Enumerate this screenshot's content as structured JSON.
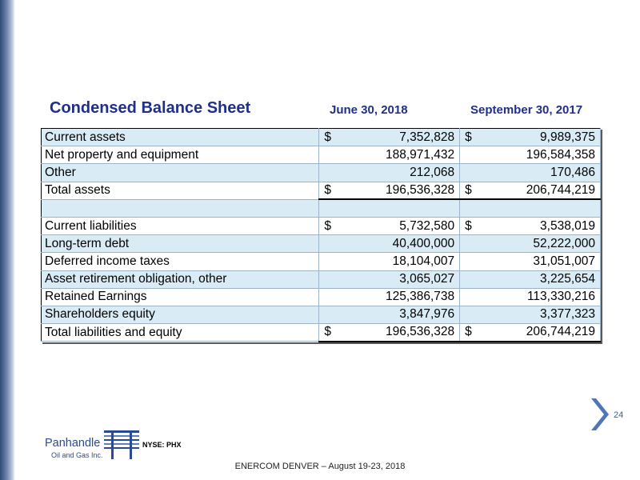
{
  "title": "Condensed Balance Sheet",
  "columns": [
    "June 30, 2018",
    "September 30, 2017"
  ],
  "rows": [
    {
      "label": "Current assets",
      "dollar": [
        "$",
        "$"
      ],
      "values": [
        "7,352,828",
        "9,989,375"
      ]
    },
    {
      "label": "Net property and equipment",
      "dollar": [
        "",
        ""
      ],
      "values": [
        "188,971,432",
        "196,584,358"
      ]
    },
    {
      "label": "Other",
      "dollar": [
        "",
        ""
      ],
      "values": [
        "212,068",
        "170,486"
      ]
    },
    {
      "label": "Total assets",
      "dollar": [
        "$",
        "$"
      ],
      "values": [
        "196,536,328",
        "206,744,219"
      ]
    },
    {
      "label": "",
      "dollar": [
        "",
        ""
      ],
      "values": [
        "",
        ""
      ]
    },
    {
      "label": "Current liabilities",
      "dollar": [
        "$",
        "$"
      ],
      "values": [
        "5,732,580",
        "3,538,019"
      ]
    },
    {
      "label": "Long-term debt",
      "dollar": [
        "",
        ""
      ],
      "values": [
        "40,400,000",
        "52,222,000"
      ]
    },
    {
      "label": "Deferred income taxes",
      "dollar": [
        "",
        ""
      ],
      "values": [
        "18,104,007",
        "31,051,007"
      ]
    },
    {
      "label": "Asset retirement obligation, other",
      "dollar": [
        "",
        ""
      ],
      "values": [
        "3,065,027",
        "3,225,654"
      ]
    },
    {
      "label": "Retained Earnings",
      "dollar": [
        "",
        ""
      ],
      "values": [
        "125,386,738",
        "113,330,216"
      ]
    },
    {
      "label": "Shareholders equity",
      "dollar": [
        "",
        ""
      ],
      "values": [
        "3,847,976",
        "3,377,323"
      ]
    },
    {
      "label": "Total liabilities and equity",
      "dollar": [
        "$",
        "$"
      ],
      "values": [
        "196,536,328",
        "206,744,219"
      ]
    }
  ],
  "page_number": "24",
  "logo": {
    "name": "Panhandle",
    "sub": "Oil and Gas Inc.",
    "ticker": "NYSE: PHX"
  },
  "footer": "ENERCOM DENVER – August 19-23, 2018",
  "colors": {
    "title": "#1f2f8a",
    "row_shade": "#d9ecf6",
    "chevron": "#4f77b8",
    "left_bar": "#2e4a78"
  },
  "icons": {
    "next": "chevron-right-icon",
    "logo_mark": "panhandle-logo-mark-icon"
  }
}
